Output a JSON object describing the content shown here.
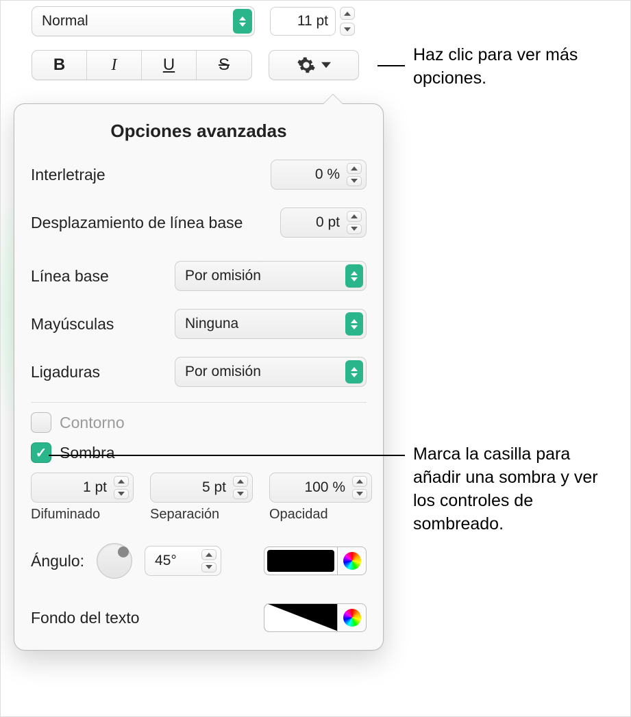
{
  "top": {
    "style": "Normal",
    "size": "11 pt"
  },
  "format_buttons": {
    "bold": "B",
    "italic": "I",
    "underline": "U",
    "strike": "S"
  },
  "popover": {
    "title": "Opciones avanzadas",
    "tracking_label": "Interletraje",
    "tracking_value": "0 %",
    "baseline_shift_label": "Desplazamiento de línea base",
    "baseline_shift_value": "0 pt",
    "baseline_label": "Línea base",
    "baseline_value": "Por omisión",
    "caps_label": "Mayúsculas",
    "caps_value": "Ninguna",
    "ligatures_label": "Ligaduras",
    "ligatures_value": "Por omisión",
    "outline_label": "Contorno",
    "shadow_label": "Sombra",
    "shadow": {
      "blur_value": "1 pt",
      "blur_label": "Difuminado",
      "offset_value": "5 pt",
      "offset_label": "Separación",
      "opacity_value": "100 %",
      "opacity_label": "Opacidad",
      "angle_label": "Ángulo:",
      "angle_value": "45°"
    },
    "textbg_label": "Fondo del texto"
  },
  "callouts": {
    "gear": "Haz clic para ver más opciones.",
    "shadow": "Marca la casilla para añadir una sombra y ver los controles de sombreado."
  }
}
